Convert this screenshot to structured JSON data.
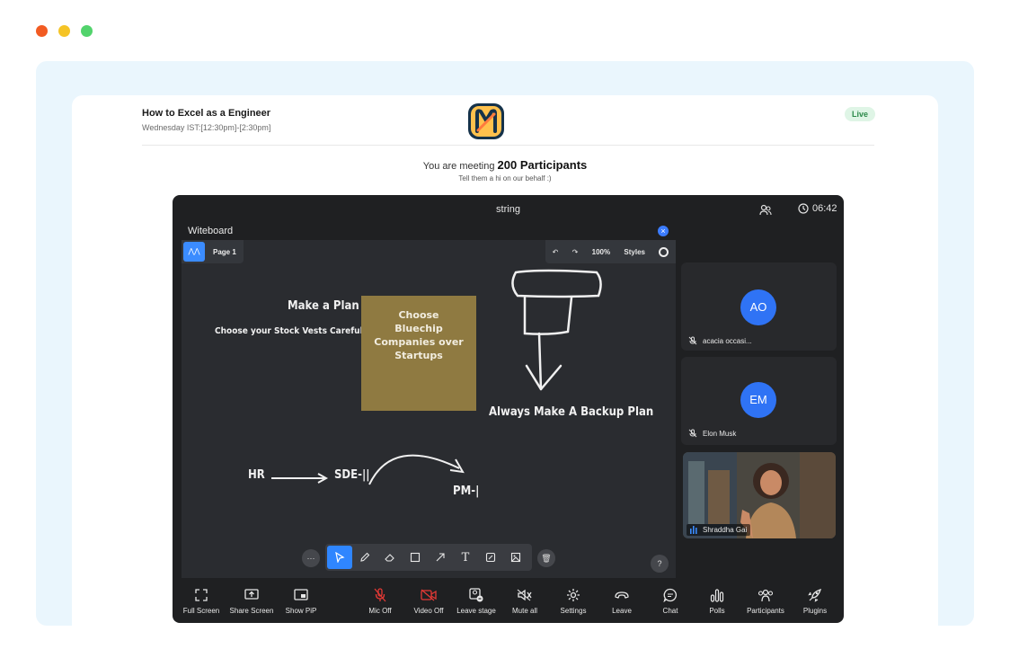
{
  "window": {
    "dot_colors": [
      "#f25b22",
      "#f5c426",
      "#52d36c"
    ]
  },
  "meeting": {
    "title": "How to Excel as a Engineer",
    "schedule": "Wednesday IST:[12:30pm]-[2:30pm]",
    "status_badge": "Live",
    "meeting_prefix": "You are meeting",
    "participants_text": "200 Participants",
    "subtitle": "Tell them a hi on our behalf :)"
  },
  "call": {
    "title": "string",
    "timer": "06:42",
    "whiteboard_label": "Witeboard",
    "page_label": "Page 1",
    "zoom": "100%",
    "styles_label": "Styles",
    "help_label": "?"
  },
  "whiteboard": {
    "sticky_note": "Choose Bluechip Companies over Startups",
    "text_make_plan": "Make a Plan",
    "text_stock": "Choose your Stock Vests Carefully",
    "text_backup": "Always Make A Backup Plan",
    "text_hr": "HR",
    "text_sde": "SDE-||",
    "text_pm": "PM-|"
  },
  "participants": [
    {
      "initials": "AO",
      "name": "acacia occasi...",
      "muted": true
    },
    {
      "initials": "EM",
      "name": "Elon Musk",
      "muted": true
    },
    {
      "name": "Shraddha Gai",
      "speaking": true
    }
  ],
  "controls": {
    "full_screen": "Full Screen",
    "share_screen": "Share Screen",
    "show_pip": "Show PiP",
    "mic_off": "Mic Off",
    "video_off": "Video Off",
    "leave_stage": "Leave stage",
    "mute_all": "Mute all",
    "settings": "Settings",
    "leave": "Leave",
    "chat": "Chat",
    "polls": "Polls",
    "participants": "Participants",
    "plugins": "Plugins"
  },
  "colors": {
    "accent": "#2f86ff",
    "danger": "#e53935",
    "live_bg": "#dff5e6",
    "sticky": "#8f7a41"
  }
}
